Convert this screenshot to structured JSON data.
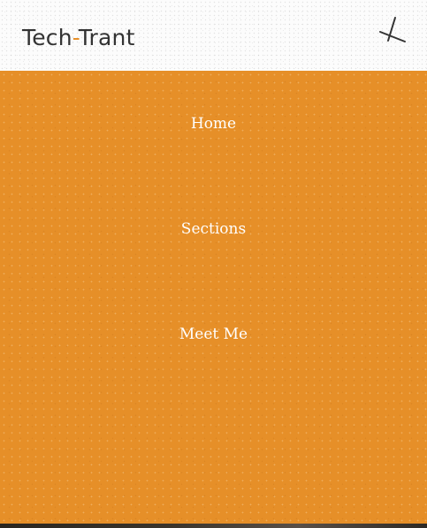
{
  "header": {
    "brand_part1": "Tech",
    "brand_sep": "-",
    "brand_part2": "Trant",
    "close_icon": "close-icon"
  },
  "menu": {
    "items": [
      {
        "label": "Home"
      },
      {
        "label": "Sections"
      },
      {
        "label": "Meet Me"
      }
    ]
  },
  "colors": {
    "accent": "#e68f28",
    "text_dark": "#333333",
    "menu_text": "#ffffff"
  }
}
